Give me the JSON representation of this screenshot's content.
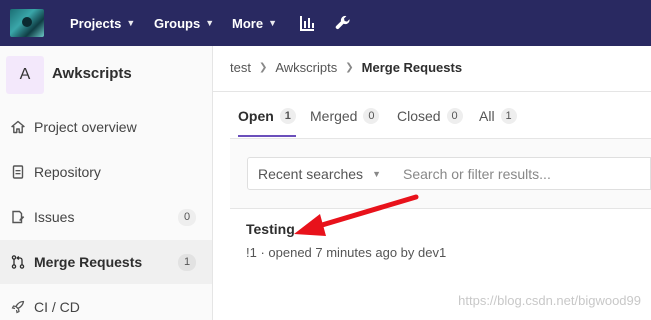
{
  "topnav": {
    "projects": "Projects",
    "groups": "Groups",
    "more": "More",
    "chart_icon": "chart-bar-icon",
    "wrench_icon": "wrench-icon"
  },
  "project": {
    "avatar_letter": "A",
    "name": "Awkscripts"
  },
  "sidebar": {
    "items": [
      {
        "label": "Project overview",
        "icon": "home-icon"
      },
      {
        "label": "Repository",
        "icon": "document-icon"
      },
      {
        "label": "Issues",
        "icon": "issues-icon",
        "count": "0"
      },
      {
        "label": "Merge Requests",
        "icon": "merge-request-icon",
        "count": "1",
        "active": true
      },
      {
        "label": "CI / CD",
        "icon": "rocket-icon"
      }
    ]
  },
  "breadcrumb": {
    "items": [
      "test",
      "Awkscripts",
      "Merge Requests"
    ]
  },
  "tabs": [
    {
      "label": "Open",
      "count": "1"
    },
    {
      "label": "Merged",
      "count": "0"
    },
    {
      "label": "Closed",
      "count": "0"
    },
    {
      "label": "All",
      "count": "1"
    }
  ],
  "filter": {
    "recent_label": "Recent searches",
    "search_placeholder": "Search or filter results..."
  },
  "merge_request": {
    "title": "Testing",
    "meta": "!1 · opened 7 minutes ago by dev1"
  },
  "watermark": "https://blog.csdn.net/bigwood99",
  "colors": {
    "topbar": "#292961",
    "active_tab_underline": "#6b4fbb",
    "annotation_arrow": "#e8121b"
  }
}
